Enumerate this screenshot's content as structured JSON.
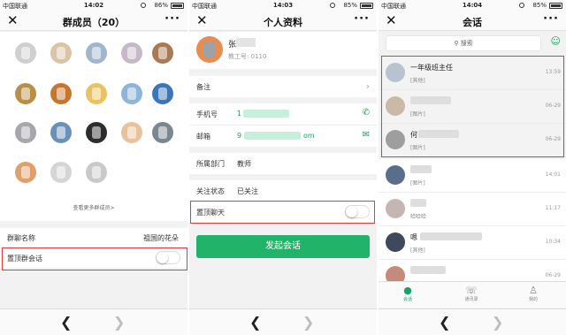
{
  "colors": {
    "accent": "#22b36b",
    "highlight": "#e8383d"
  },
  "status_bars": [
    {
      "carrier": "中国联通",
      "time": "14:02",
      "battery": "86%",
      "battery_level": 0.86
    },
    {
      "carrier": "中国联通",
      "time": "14:03",
      "battery": "85%",
      "battery_level": 0.85
    },
    {
      "carrier": "中国联通",
      "time": "14:04",
      "battery": "85%",
      "battery_level": 0.85
    }
  ],
  "icons": {
    "close": "close-icon",
    "more": "more-icon",
    "back": "chevron-left-icon",
    "forward": "chevron-right-icon",
    "search": "search-icon",
    "contacts": "contacts-icon"
  },
  "group_members": {
    "title": "群成员（20）",
    "more_members": "查看更多群成员>",
    "group_name_label": "群聊名称",
    "group_name_value": "祖国的花朵",
    "pin_label": "置顶群会话",
    "pin_on": false
  },
  "profile": {
    "title": "个人资料",
    "name": "张",
    "staff_label": "教工号: 0110",
    "remark_label": "备注",
    "phone_label": "手机号",
    "phone_value": "1",
    "email_label": "邮箱",
    "email_value": "9",
    "email_suffix": "om",
    "dept_label": "所属部门",
    "dept_value": "教师",
    "follow_label": "关注状态",
    "follow_value": "已关注",
    "pin_label": "置顶聊天",
    "pin_on": false,
    "start_chat": "发起会话"
  },
  "chats": {
    "title": "会话",
    "search_placeholder": "搜索",
    "items": [
      {
        "name": "一年级班主任",
        "preview": "[其他]",
        "time": "13:59",
        "pinned": true
      },
      {
        "name": "",
        "preview": "[图片]",
        "time": "06-29",
        "pinned": true
      },
      {
        "name": "何",
        "preview": "[图片]",
        "time": "06-29",
        "pinned": true
      },
      {
        "name": "",
        "preview": "[图片]",
        "time": "14:01",
        "pinned": false
      },
      {
        "name": "",
        "preview": "哈哈哈",
        "time": "11:17",
        "pinned": false
      },
      {
        "name": "嗯",
        "preview": "[其他]",
        "time": "10:34",
        "pinned": false
      },
      {
        "name": "",
        "preview": "",
        "time": "06-29",
        "pinned": false
      }
    ],
    "tabs": [
      {
        "label": "会话",
        "icon": "chat-icon",
        "active": true
      },
      {
        "label": "通讯录",
        "icon": "contacts-book-icon",
        "active": false
      },
      {
        "label": "我的",
        "icon": "person-icon",
        "active": false
      }
    ]
  }
}
